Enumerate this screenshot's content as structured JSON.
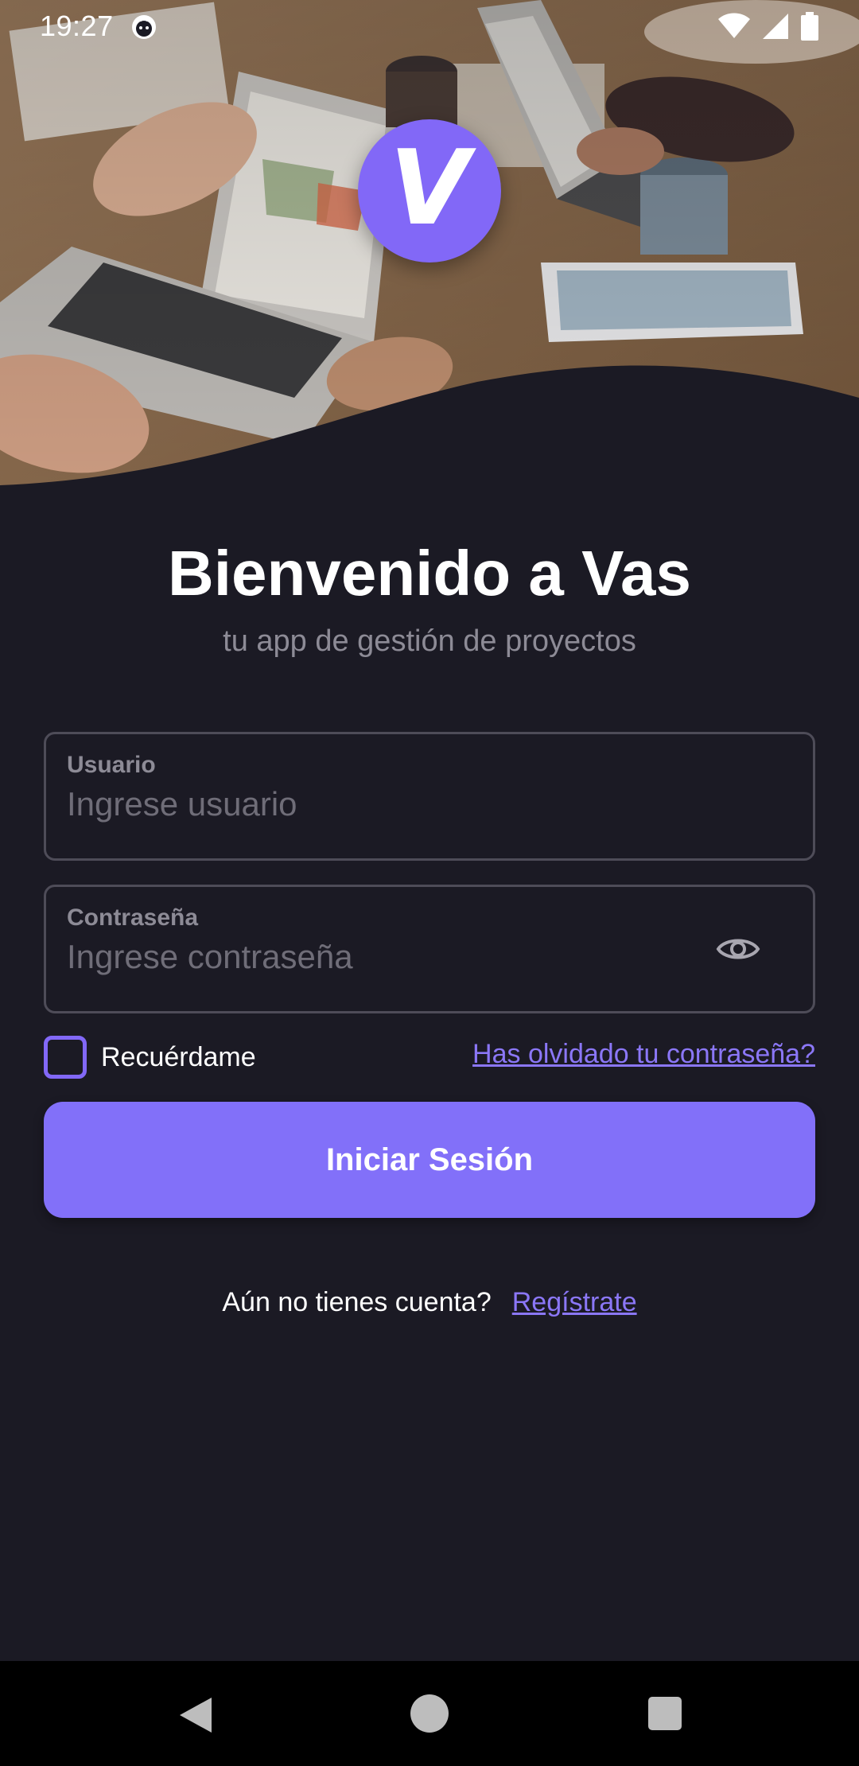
{
  "status_bar": {
    "time": "19:27",
    "icons": [
      "cat-notification-icon",
      "wifi-icon",
      "signal-icon",
      "battery-icon"
    ]
  },
  "hero": {
    "image": "office-meeting-laptops-photo",
    "logo_letter": "V",
    "logo_color": "#8268f7"
  },
  "header": {
    "title": "Bienvenido a Vas",
    "subtitle": "tu app de gestión de proyectos"
  },
  "form": {
    "username": {
      "label": "Usuario",
      "placeholder": "Ingrese usuario",
      "value": ""
    },
    "password": {
      "label": "Contraseña",
      "placeholder": "Ingrese contraseña",
      "value": "",
      "toggle_icon": "eye-icon"
    },
    "remember_label": "Recuérdame",
    "remember_checked": false,
    "forgot_link": "Has olvidado tu contraseña?",
    "submit_label": "Iniciar Sesión"
  },
  "signup": {
    "prompt": "Aún no tienes cuenta?",
    "link": "Regístrate"
  },
  "colors": {
    "background": "#1b1a24",
    "accent": "#8270f9",
    "link": "#8b77f7"
  },
  "navbar": {
    "icons": [
      "back-icon",
      "home-icon",
      "recents-icon"
    ]
  }
}
